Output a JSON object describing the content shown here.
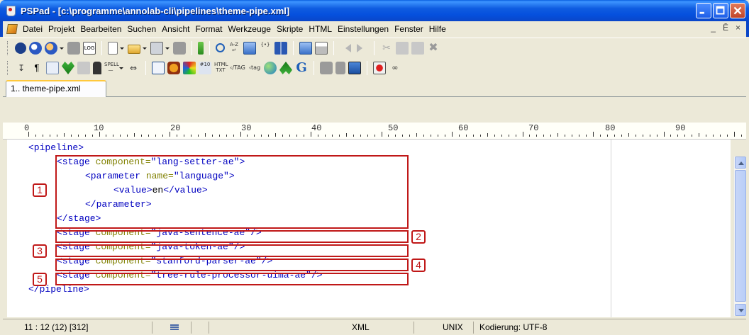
{
  "window": {
    "title": "PSPad - [c:\\programme\\annolab-cli\\pipelines\\theme-pipe.xml]"
  },
  "menu": {
    "items": [
      "Datei",
      "Projekt",
      "Bearbeiten",
      "Suchen",
      "Ansicht",
      "Format",
      "Werkzeuge",
      "Skripte",
      "HTML",
      "Einstellungen",
      "Fenster",
      "Hilfe"
    ],
    "right_controls": [
      "_",
      "Ē",
      "×"
    ]
  },
  "tabs": [
    {
      "label": "1.. theme-pipe.xml"
    }
  ],
  "ruler": {
    "labels": [
      "0",
      "10",
      "20",
      "30",
      "40",
      "50",
      "60",
      "70",
      "80",
      "90"
    ]
  },
  "editor": {
    "lines": [
      "<pipeline>",
      "    <stage component=\"lang-setter-ae\">",
      "        <parameter name=\"language\">",
      "            <value>en</value>",
      "        </parameter>",
      "    </stage>",
      "    <stage component=\"java-sentence-ae\"/>",
      "    <stage component=\"java-token-ae\"/>",
      "    <stage component=\"stanford-parser-ae\"/>",
      "    <stage component=\"tree-rule-processor-uima-ae\"/>",
      "</pipeline>"
    ],
    "tokens": {
      "l0": {
        "t1": "<pipeline>"
      },
      "l1": {
        "t1": "<stage ",
        "a1": "component=",
        "v1": "\"lang-setter-ae\"",
        "t2": ">"
      },
      "l2": {
        "t1": "<parameter ",
        "a1": "name=",
        "v1": "\"language\"",
        "t2": ">"
      },
      "l3": {
        "t1": "<value>",
        "x1": "en",
        "t2": "</value>"
      },
      "l4": {
        "t1": "</parameter>"
      },
      "l5": {
        "t1": "</stage>"
      },
      "l6": {
        "t1": "<stage ",
        "a1": "component=",
        "v1": "\"java-sentence-ae\"",
        "t2": "/>"
      },
      "l7": {
        "t1": "<stage ",
        "a1": "component=",
        "v1": "\"java-token-ae\"",
        "t2": "/>"
      },
      "l8": {
        "t1": "<stage ",
        "a1": "component=",
        "v1": "\"stanford-parser-ae\"",
        "t2": "/>"
      },
      "l9": {
        "t1": "<stage ",
        "a1": "component=",
        "v1": "\"tree-rule-processor-uima-ae\"",
        "t2": "/>"
      },
      "l10": {
        "t1": "</pipeline>"
      }
    },
    "annotations": [
      "1",
      "2",
      "3",
      "4",
      "5"
    ]
  },
  "statusbar": {
    "position": "11 : 12  (12)  [312]",
    "syntax": "XML",
    "line_endings": "UNIX",
    "encoding": "Kodierung: UTF-8"
  },
  "colors": {
    "tag": "#0000c0",
    "attribute": "#808000",
    "annotation_red": "#c01818",
    "titlebar_blue": "#0550dd"
  },
  "icons": {
    "toolbar1": [
      "project-icon",
      "open-project-icon",
      "save-project-icon",
      "close-project-icon",
      "log-icon",
      "new-file-icon",
      "open-file-icon",
      "save-file-icon",
      "save-all-icon",
      "bookmark-icon",
      "find-icon",
      "replace-icon",
      "find-in-files-icon",
      "bracket-icon",
      "book-icon",
      "preview-icon",
      "print-icon",
      "undo-icon",
      "redo-icon",
      "cut-icon",
      "copy-icon",
      "paste-icon",
      "delete-icon"
    ],
    "toolbar2": [
      "wrap-icon",
      "pilcrow-icon",
      "column-icon",
      "highlighter-icon",
      "text-block-icon",
      "lock-icon",
      "spell-icon",
      "bookmark-nav-icon",
      "code-explorer-icon",
      "clip-icon",
      "color-picker-icon",
      "html-table-icon",
      "html-text-icon",
      "tag-close-icon",
      "tag-icon",
      "globe-icon",
      "validate-icon",
      "google-icon",
      "macro-icon",
      "record-icon",
      "screen-icon",
      "red-stop-icon",
      "glasses-icon"
    ]
  }
}
